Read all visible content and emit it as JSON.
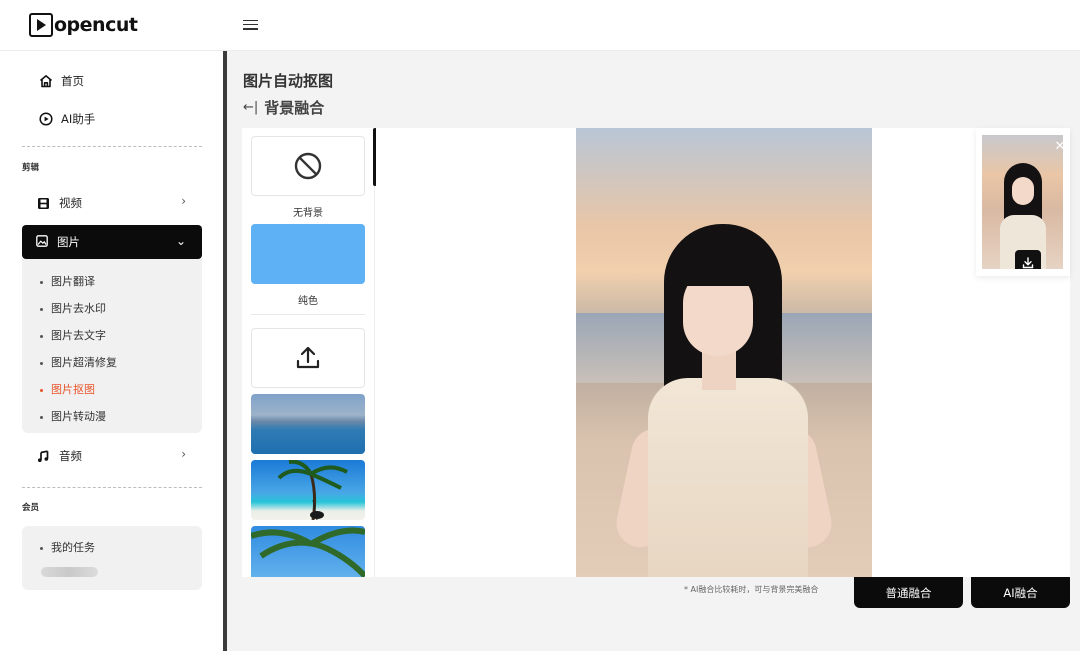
{
  "app": {
    "logo_text": "opencut"
  },
  "sidebar": {
    "home": "首页",
    "assistant": "AI助手",
    "section_edit": "剪辑",
    "video": "视频",
    "image": "图片",
    "image_sub": [
      "图片翻译",
      "图片去水印",
      "图片去文字",
      "图片超清修复",
      "图片抠图",
      "图片转动漫"
    ],
    "audio": "音频",
    "section_member": "会员",
    "my_tasks": "我的任务"
  },
  "main": {
    "title": "图片自动抠图",
    "back_label": "背景融合",
    "back_arrow": "←|",
    "bg_options": {
      "none_label": "无背景",
      "solid_label": "纯色",
      "solid_color": "#5eb1f4"
    },
    "hint": "* AI融合比较耗时，可与背景完美融合",
    "btn_normal": "普通融合",
    "btn_ai": "AI融合"
  }
}
